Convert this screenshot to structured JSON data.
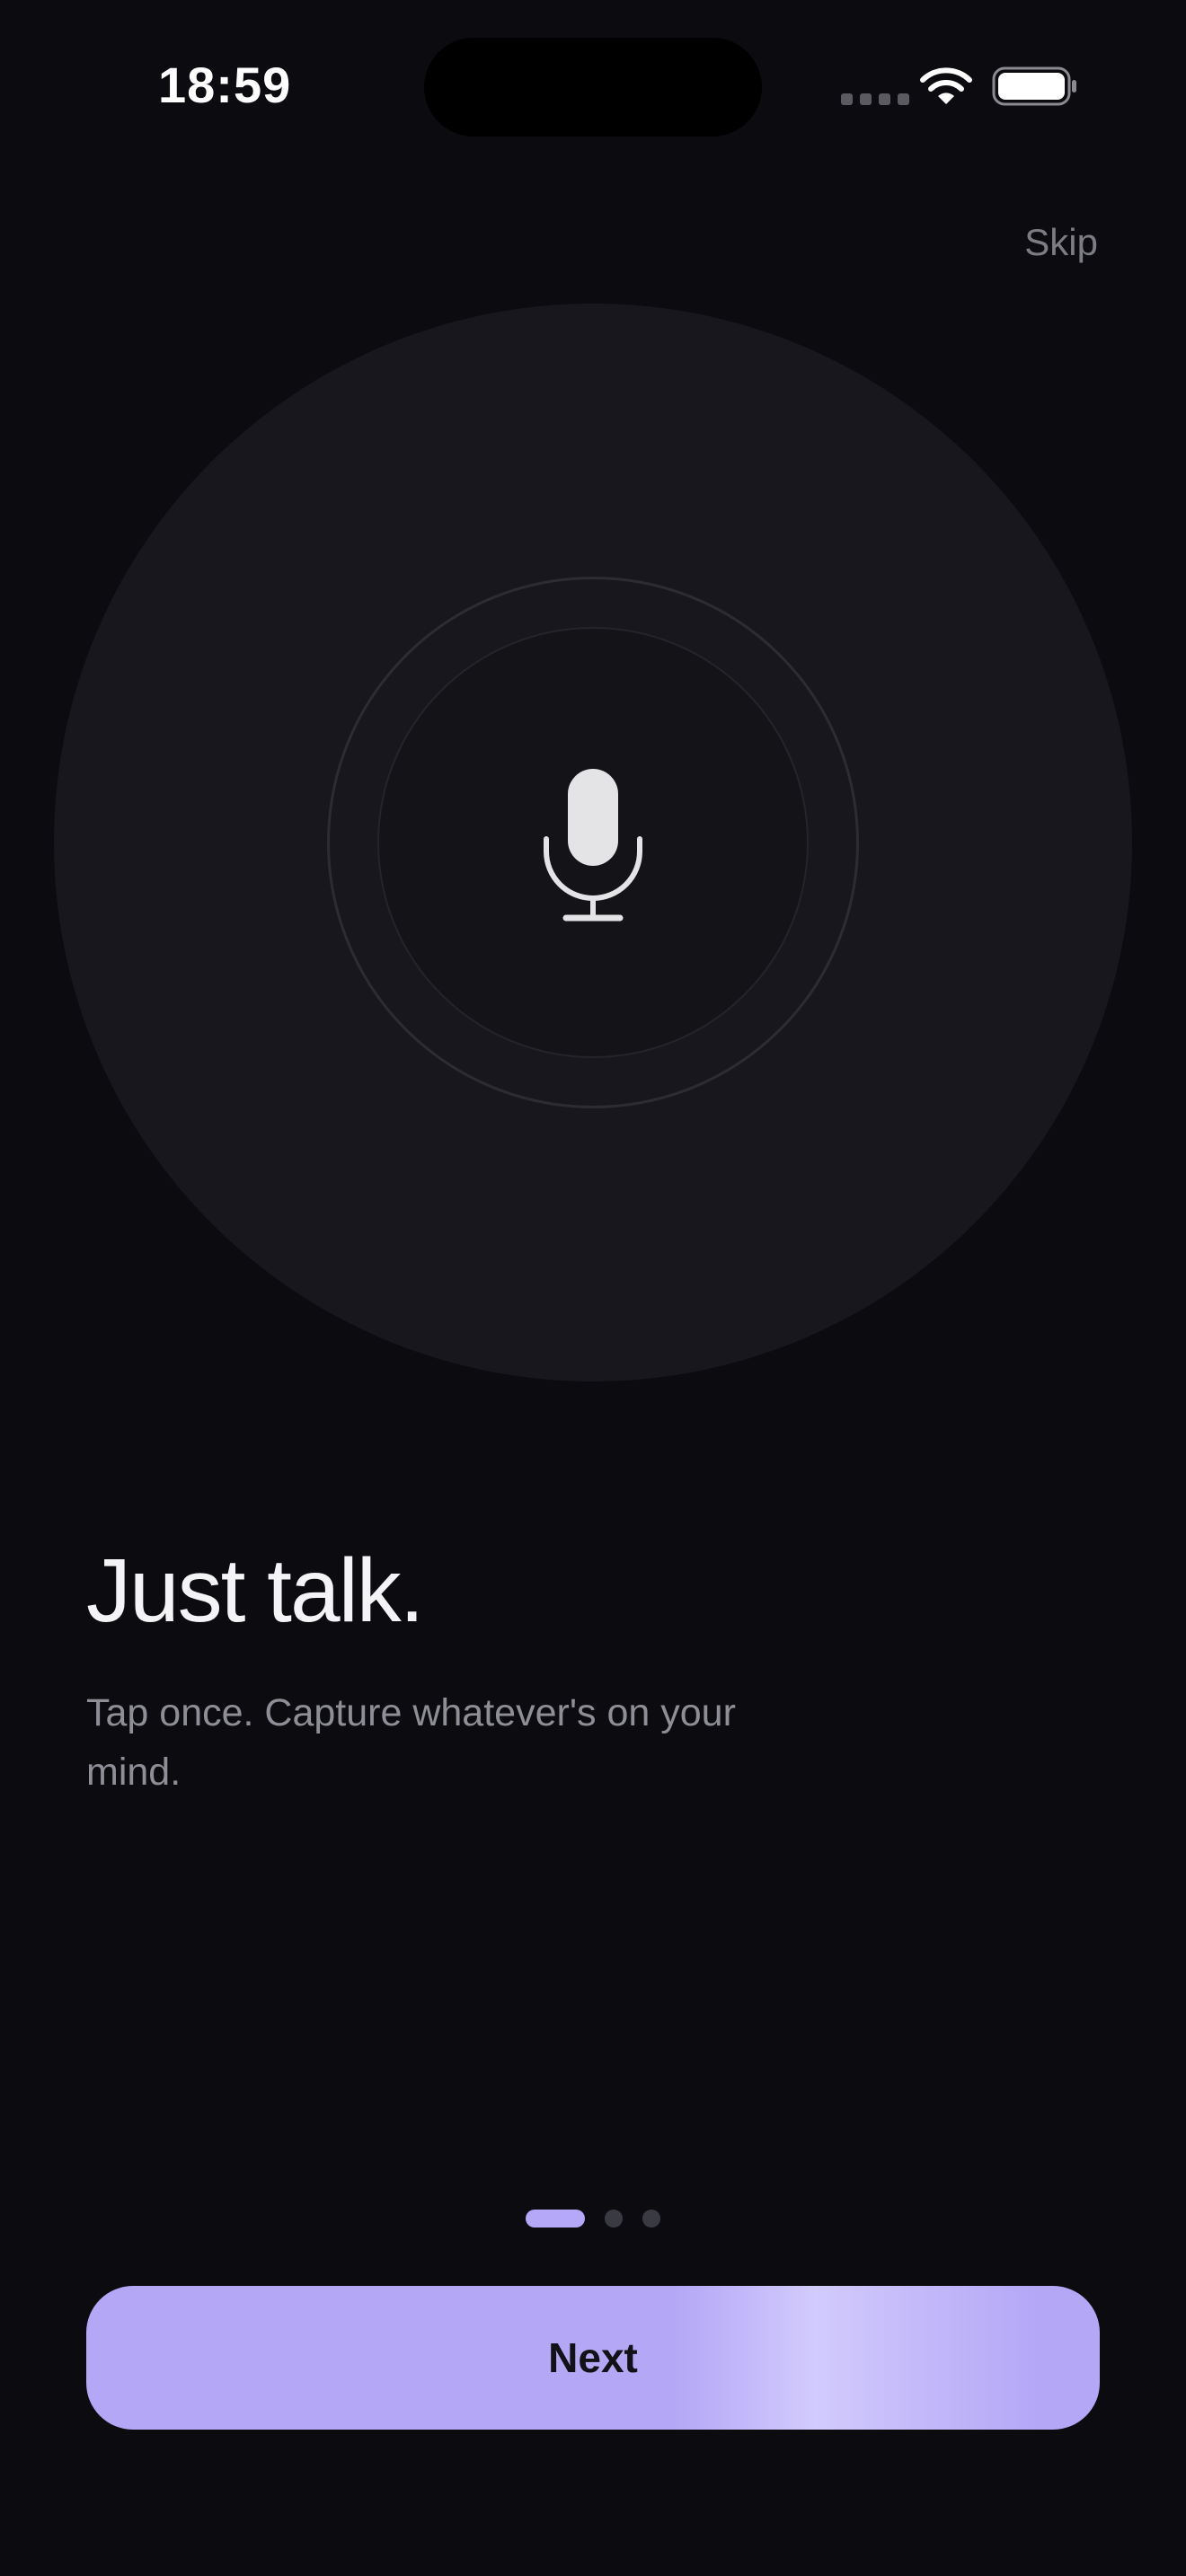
{
  "status_bar": {
    "time": "18:59"
  },
  "skip_label": "Skip",
  "hero": {
    "icon": "microphone-icon"
  },
  "headline": "Just talk.",
  "subtitle": "Tap once. Capture whatever's on your mind.",
  "pager": {
    "total": 3,
    "active_index": 0
  },
  "next_label": "Next",
  "colors": {
    "background": "#0c0c10",
    "accent": "#b4a7f6",
    "disc": "#17171d"
  }
}
